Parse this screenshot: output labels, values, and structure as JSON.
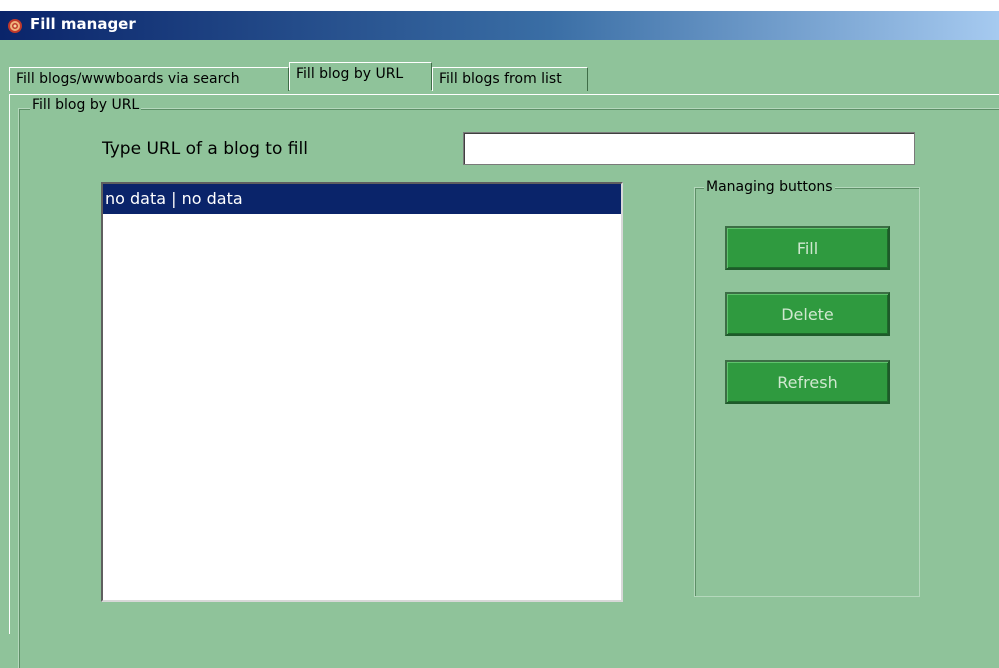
{
  "window": {
    "title": "Fill manager",
    "icon": "app-logo-icon"
  },
  "tabs": [
    {
      "label": "Fill blogs/wwwboards via search",
      "active": false
    },
    {
      "label": "Fill blog by URL",
      "active": true
    },
    {
      "label": "Fill blogs from list",
      "active": false
    }
  ],
  "group": {
    "legend": "Fill blog by URL"
  },
  "url": {
    "label": "Type URL of a blog to fill",
    "value": "",
    "placeholder": ""
  },
  "list": {
    "items": [
      "no data | no data"
    ],
    "selected_index": 0
  },
  "buttons": {
    "legend": "Managing buttons",
    "fill": "Fill",
    "delete": "Delete",
    "refresh": "Refresh"
  },
  "colors": {
    "titlebar": "#0a246a",
    "background": "#8fc39a",
    "button": "#2f9a3f",
    "selection": "#0a246a"
  }
}
